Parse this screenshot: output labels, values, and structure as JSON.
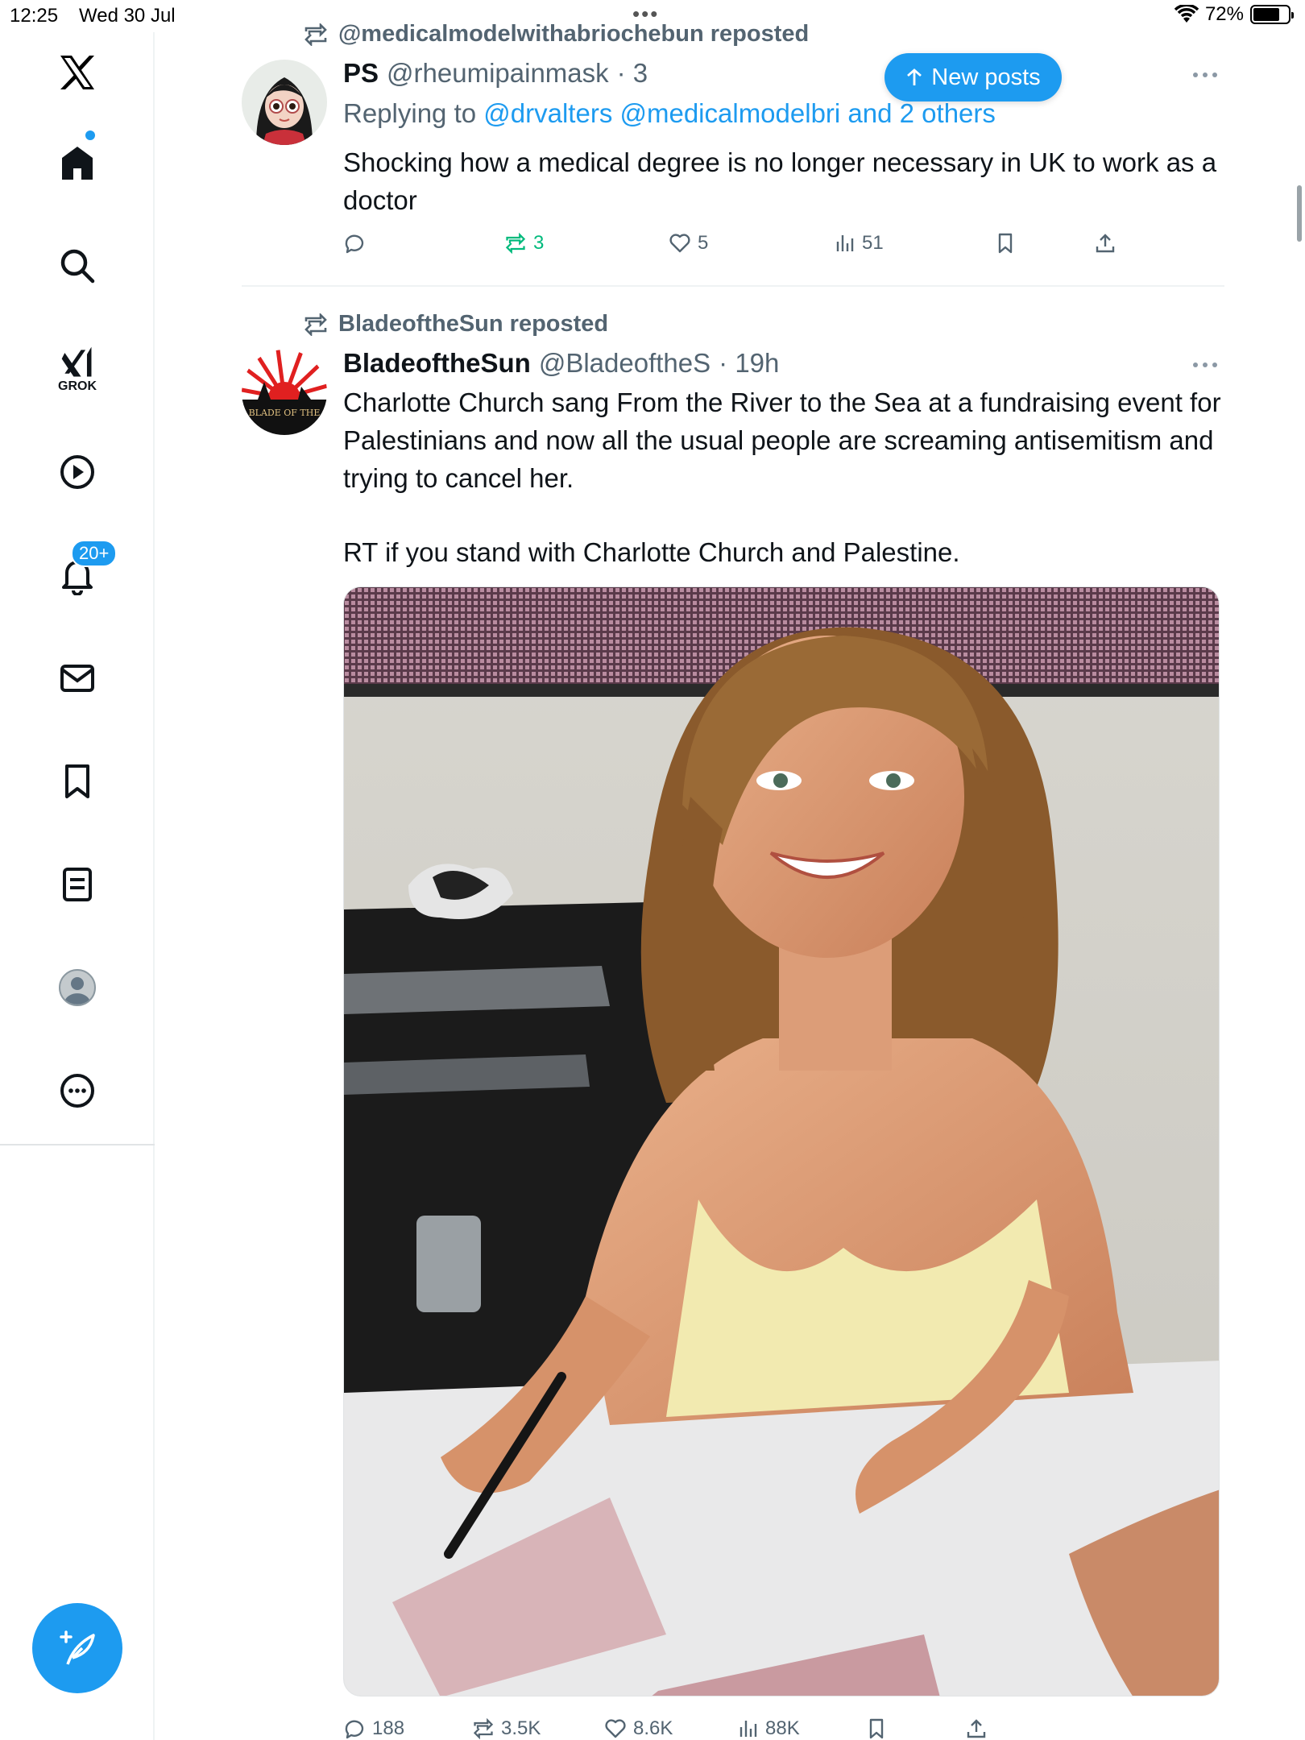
{
  "status_bar": {
    "time": "12:25",
    "date": "Wed 30 Jul",
    "battery": "72%"
  },
  "sidebar": {
    "grok_label": "GROK",
    "notifications_badge": "20+"
  },
  "feed": {
    "new_posts_label": "New posts",
    "tweets": [
      {
        "reposted_by": "@medicalmodelwithabriochebun reposted",
        "display_name": "PS",
        "handle": "@rheumipainmask",
        "time_partial": "· 3",
        "replying_prefix": "Replying to",
        "replying_targets": "@drvalters @medicalmodelbri and 2 others",
        "text": "Shocking how a medical degree is no longer necessary in UK to work as a doctor",
        "stats": {
          "replies": "",
          "reposts": "3",
          "likes": "5",
          "views": "51"
        }
      },
      {
        "reposted_by": "BladeoftheSun reposted",
        "display_name": "BladeoftheSun",
        "handle": "@BladeoftheS",
        "time": "· 19h",
        "avatar_text": "BLADE OF THE",
        "text_line1": "Charlotte Church sang From the River to the Sea at a fundraising event for Palestinians and now all the usual people are screaming antisemitism and trying to cancel her.",
        "text_line2": "RT if you stand with Charlotte Church and Palestine.",
        "stats": {
          "replies": "188",
          "reposts": "3.5K",
          "likes": "8.6K",
          "views": "88K"
        }
      }
    ]
  },
  "colors": {
    "accent": "#1d9bf0",
    "repost_green": "#00ba7c",
    "secondary_text": "#536471"
  }
}
